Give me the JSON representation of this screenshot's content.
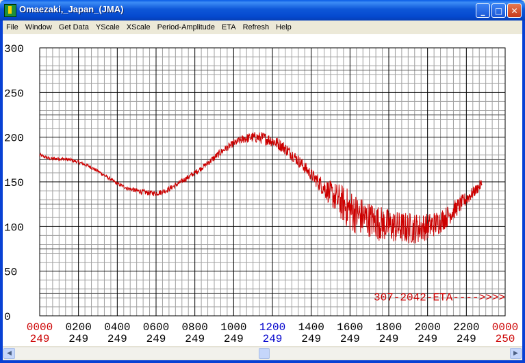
{
  "window": {
    "title": "Omaezaki,_Japan_(JMA)",
    "buttons": {
      "minimize": "_",
      "maximize": "□",
      "close": "✕"
    }
  },
  "menu": [
    "File",
    "Window",
    "Get Data",
    "YScale",
    "XScale",
    "Period-Amplitude",
    "ETA",
    "Refresh",
    "Help"
  ],
  "colors": {
    "trace": "#cc0000",
    "eta": "#cc0000",
    "grid_major": "#000000",
    "grid_minor": "#a0a0a0",
    "highlight_tick": "#0000cc"
  },
  "chart_data": {
    "type": "line",
    "y_ticks": [
      "300",
      "250",
      "200",
      "150",
      "100",
      "50",
      "0"
    ],
    "ylim": [
      0,
      300
    ],
    "x_time_labels": [
      "0000",
      "0200",
      "0400",
      "0600",
      "0800",
      "1000",
      "1200",
      "1400",
      "1600",
      "1800",
      "2000",
      "2200",
      "0000"
    ],
    "x_day_labels": [
      "249",
      "249",
      "249",
      "249",
      "249",
      "249",
      "249",
      "249",
      "249",
      "249",
      "249",
      "249",
      "250"
    ],
    "x_label_colors": [
      "red",
      "black",
      "black",
      "black",
      "black",
      "black",
      "blue",
      "black",
      "black",
      "black",
      "black",
      "black",
      "red"
    ],
    "xlim_hours": [
      0,
      24
    ],
    "eta_annotation": "307-2042-ETA---->>>>",
    "series": [
      {
        "x_hours": [
          0,
          0.5,
          1,
          1.5,
          2,
          2.5,
          3,
          3.5,
          4,
          4.5,
          5,
          5.5,
          6,
          6.5,
          7,
          7.5,
          8,
          8.5,
          9,
          9.5,
          10,
          10.5,
          11,
          11.5,
          12,
          12.5,
          13,
          13.5,
          14,
          14.5,
          15,
          15.5,
          16,
          16.5,
          17,
          17.5,
          18,
          18.5,
          19,
          19.5,
          20,
          20.5,
          21,
          21.5,
          22,
          22.5,
          22.8
        ],
        "values": [
          180,
          176,
          176,
          175,
          172,
          168,
          162,
          155,
          148,
          143,
          140,
          138,
          137,
          140,
          146,
          153,
          160,
          168,
          177,
          186,
          193,
          198,
          200,
          199,
          196,
          190,
          181,
          170,
          158,
          147,
          137,
          128,
          118,
          112,
          108,
          104,
          101,
          99,
          98,
          98,
          100,
          104,
          111,
          121,
          131,
          141,
          148
        ],
        "noise": [
          2,
          2,
          2,
          2,
          2,
          2,
          2,
          2,
          2,
          2,
          3,
          3,
          3,
          3,
          3,
          3,
          3,
          3,
          4,
          4,
          4,
          5,
          6,
          7,
          7,
          7,
          7,
          7,
          7,
          10,
          14,
          20,
          24,
          22,
          20,
          20,
          19,
          18,
          18,
          17,
          15,
          14,
          12,
          10,
          8,
          6,
          6
        ]
      }
    ]
  }
}
